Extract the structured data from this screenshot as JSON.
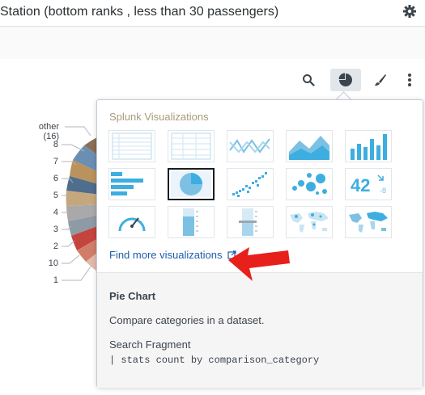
{
  "header": {
    "title": "Station (bottom ranks , less than 30 passengers)",
    "settings_icon": "gear-icon"
  },
  "toolbar": {
    "search_icon": "search-icon",
    "viz_icon": "pie-chart-icon",
    "format_icon": "paintbrush-icon",
    "more_icon": "more-vertical-icon"
  },
  "legend_labels": [
    "other (16)",
    "8",
    "7",
    "6",
    "5",
    "4",
    "3",
    "2",
    "10",
    "1"
  ],
  "popover": {
    "heading": "Splunk Visualizations",
    "find_more": "Find more visualizations",
    "find_more_icon": "external-link-icon",
    "details": {
      "title": "Pie Chart",
      "description": "Compare categories in a dataset.",
      "fragment_label": "Search Fragment",
      "fragment": "| stats count by comparison_category"
    },
    "tiles": [
      "statistics-table-icon",
      "events-table-icon",
      "line-chart-icon",
      "area-chart-icon",
      "column-chart-icon",
      "bar-chart-icon",
      "pie-chart-icon",
      "scatter-chart-icon",
      "bubble-chart-icon",
      "single-value-icon",
      "radial-gauge-icon",
      "filler-gauge-icon",
      "marker-gauge-icon",
      "cluster-map-icon",
      "choropleth-map-icon"
    ],
    "single_value_text": "42"
  },
  "colors": {
    "accent": "#3daee0",
    "link": "#1e5ea8",
    "arrow": "#e8201b"
  }
}
